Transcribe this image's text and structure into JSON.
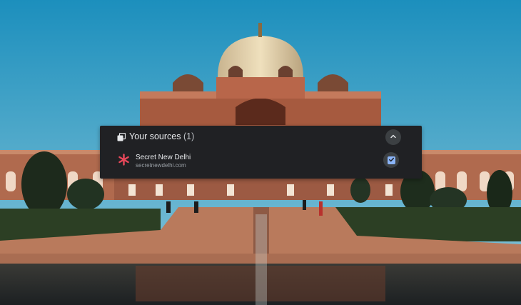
{
  "panel": {
    "title": "Your sources",
    "count": "(1)",
    "icon": "sources-icon",
    "collapse_icon": "chevron-up-icon"
  },
  "sources": [
    {
      "name": "Secret New Delhi",
      "url": "secretnewdelhi.com",
      "logo_color": "#e8485a",
      "selected": true
    }
  ],
  "colors": {
    "panel_bg": "#202124",
    "checkbox_accent": "#8ab4f8"
  }
}
